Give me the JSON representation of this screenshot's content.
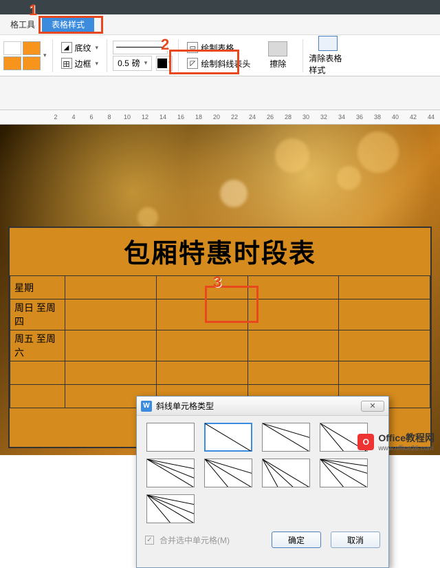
{
  "tabs": {
    "tools": "格工具",
    "active": "表格样式"
  },
  "ribbon": {
    "shading": "底纹",
    "border": "边框",
    "weight_value": "0.5",
    "weight_unit": "磅",
    "draw_table": "绘制表格",
    "draw_diagonal": "绘制斜线表头",
    "erase": "擦除",
    "clear_style": "清除表格样式"
  },
  "ruler": [
    "2",
    "4",
    "6",
    "8",
    "10",
    "12",
    "14",
    "16",
    "18",
    "20",
    "22",
    "24",
    "26",
    "28",
    "30",
    "32",
    "34",
    "36",
    "38",
    "40",
    "42",
    "44"
  ],
  "doc": {
    "title": "包厢特惠时段表",
    "rows": [
      [
        "星期",
        "",
        "",
        "",
        ""
      ],
      [
        "周日 至周四",
        "",
        "",
        "",
        ""
      ],
      [
        "周五 至周六",
        "",
        "",
        "",
        ""
      ],
      [
        "",
        "",
        "",
        "",
        ""
      ],
      [
        "",
        "",
        "",
        "",
        ""
      ]
    ]
  },
  "dialog": {
    "title": "斜线单元格类型",
    "merge_label": "合并选中单元格(M)",
    "ok": "确定",
    "cancel": "取消"
  },
  "callouts": {
    "n1": "1",
    "n2": "2",
    "n3": "3"
  },
  "watermark": {
    "brand": "Office教程网",
    "url": "www.office26.com"
  }
}
